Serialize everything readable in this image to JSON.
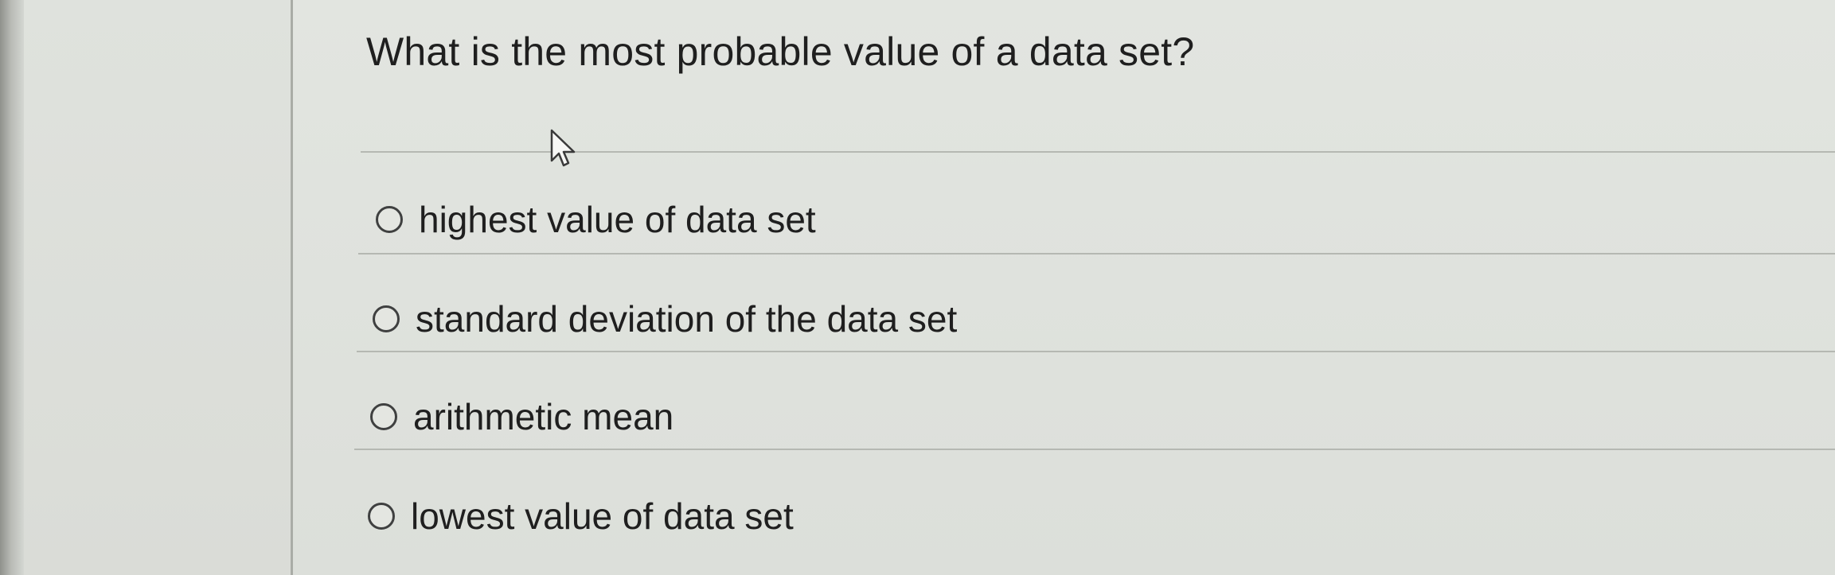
{
  "question": {
    "text": "What is the most probable value of a data set?"
  },
  "options": [
    {
      "label": "highest value of data set",
      "selected": false
    },
    {
      "label": "standard deviation of the data set",
      "selected": false
    },
    {
      "label": "arithmetic mean",
      "selected": false
    },
    {
      "label": "lowest value of data set",
      "selected": false
    }
  ],
  "cursor": {
    "icon": "arrow-cursor-icon"
  }
}
